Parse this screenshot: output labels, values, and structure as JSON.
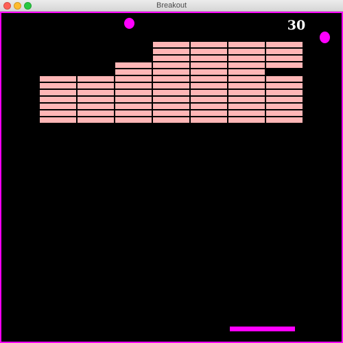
{
  "window": {
    "title": "Breakout",
    "controls": [
      "close-button",
      "minimize-button",
      "zoom-button"
    ]
  },
  "game": {
    "score": "30",
    "colors": {
      "background": "#000000",
      "border": "#ff00ff",
      "brick": "#ffb6b6",
      "ball": "#ff00ff",
      "paddle": "#ff00ff",
      "score_text": "#ffffff"
    },
    "balls": 2,
    "brick_columns": [
      {
        "rows_present": [
          5,
          6,
          7,
          8,
          9,
          10,
          11
        ]
      },
      {
        "rows_present": [
          5,
          6,
          7,
          8,
          9,
          10,
          11
        ]
      },
      {
        "rows_present": [
          3,
          4,
          5,
          6,
          7,
          8,
          9,
          10,
          11
        ]
      },
      {
        "rows_present": [
          0,
          1,
          2,
          3,
          4,
          5,
          6,
          7,
          8,
          9,
          10,
          11
        ]
      },
      {
        "rows_present": [
          0,
          1,
          2,
          3,
          4,
          5,
          6,
          7,
          8,
          9,
          10,
          11
        ]
      },
      {
        "rows_present": [
          0,
          1,
          2,
          3,
          4,
          5,
          6,
          7,
          8,
          9,
          10,
          11
        ]
      },
      {
        "rows_present": [
          0,
          1,
          2,
          3,
          5,
          6,
          7,
          8,
          9,
          10,
          11
        ]
      }
    ]
  }
}
